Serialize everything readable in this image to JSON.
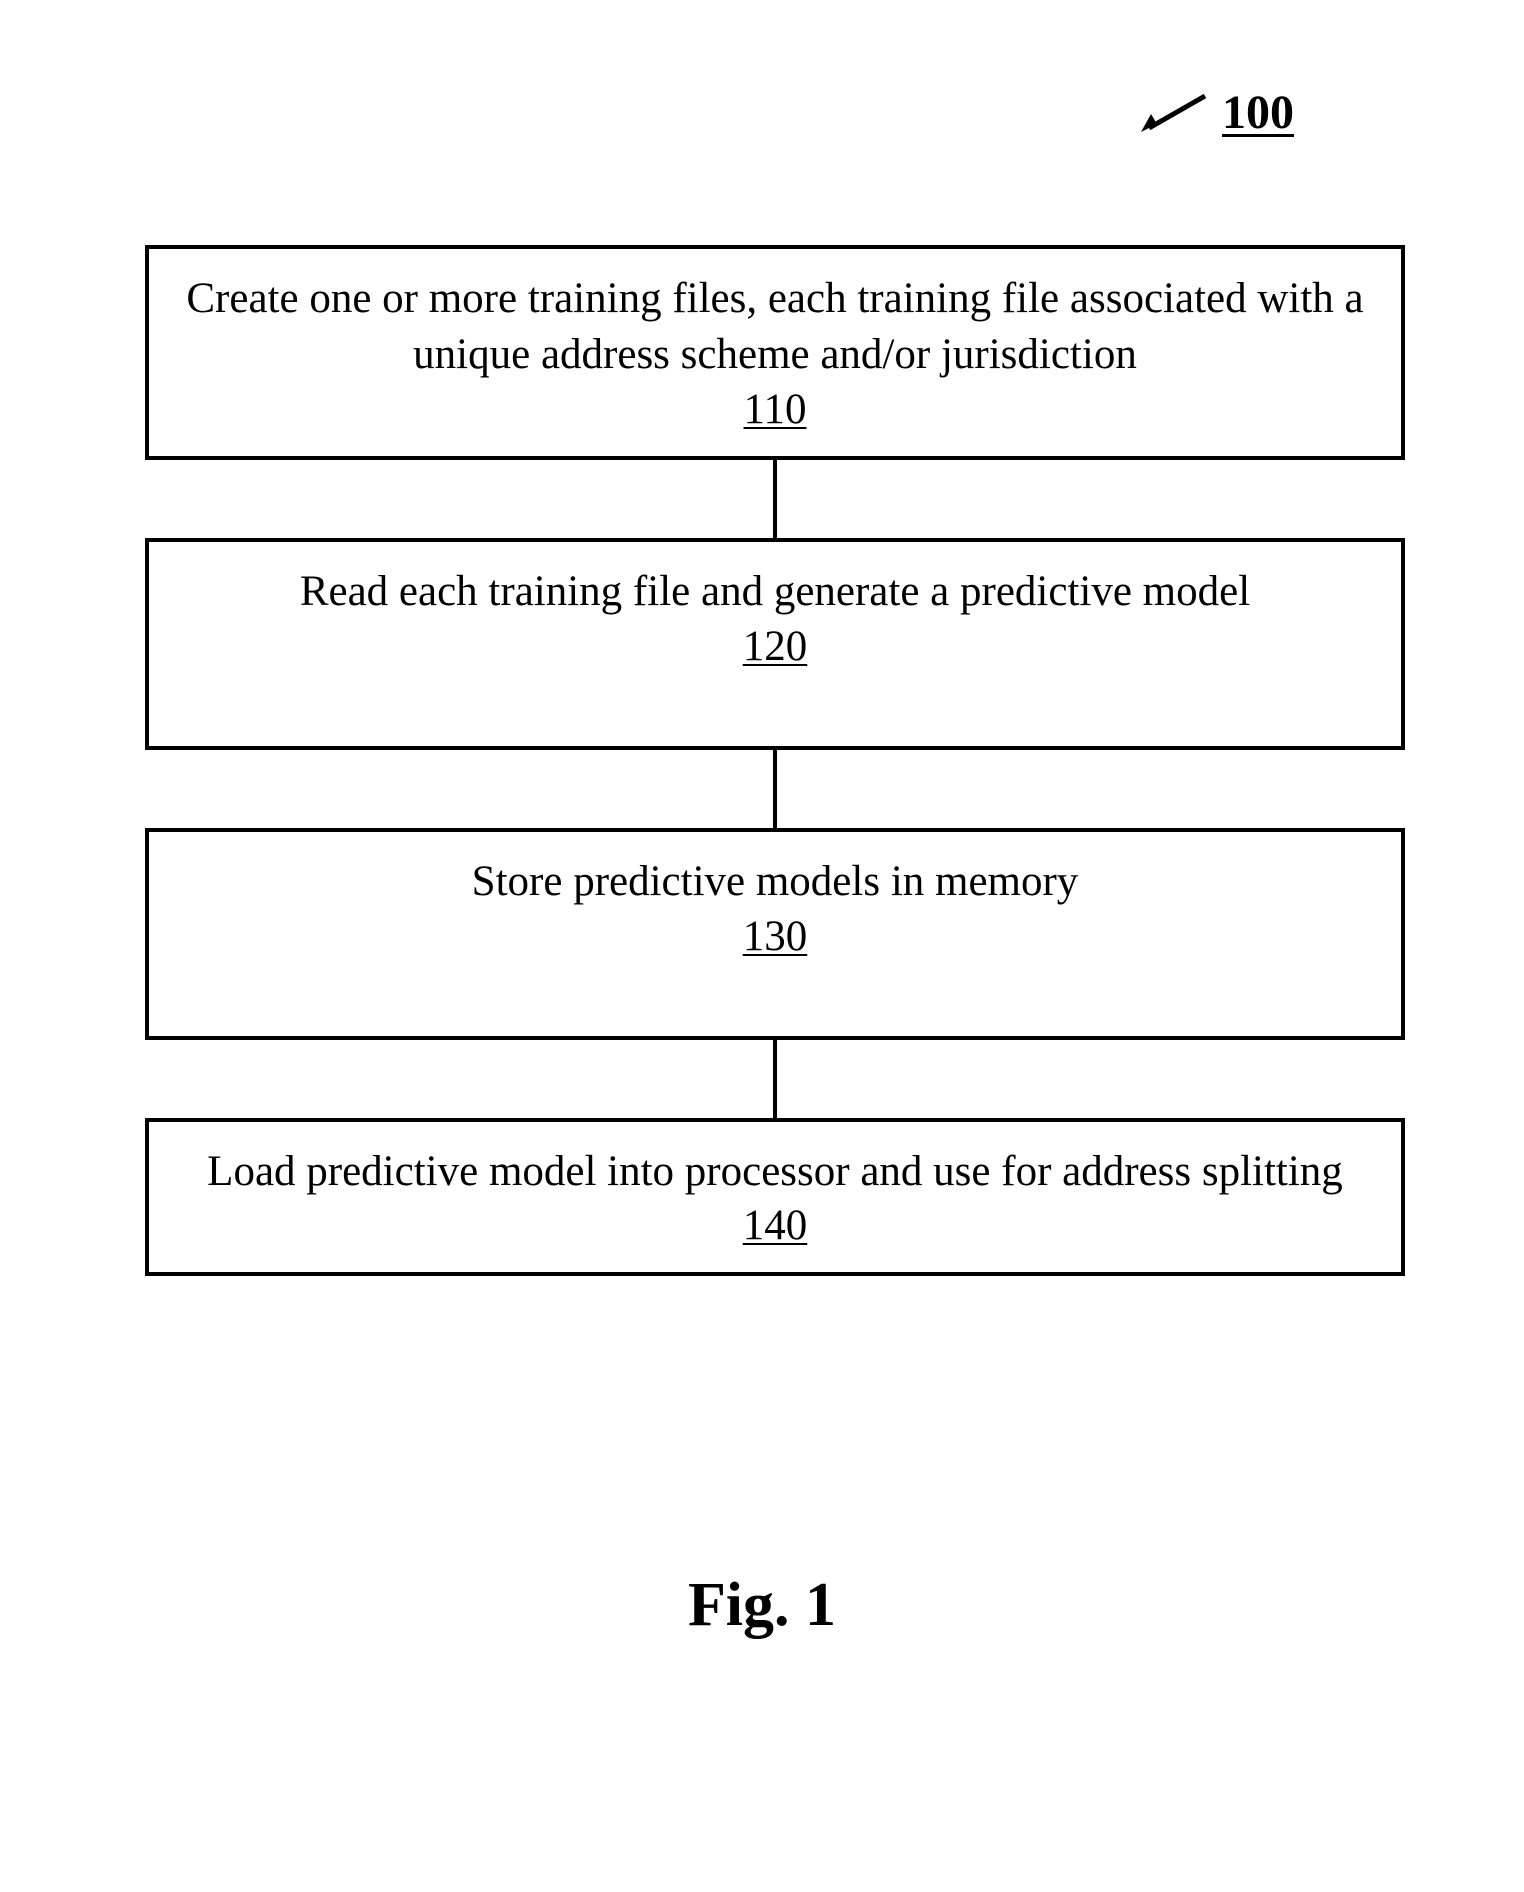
{
  "diagram": {
    "number": "100",
    "figure_label": "Fig. 1",
    "steps": [
      {
        "text": "Create one or more training files, each training file associated with a unique address scheme and/or jurisdiction",
        "number": "110"
      },
      {
        "text": "Read each training file and generate a predictive model",
        "number": "120"
      },
      {
        "text": "Store predictive models in memory",
        "number": "130"
      },
      {
        "text": "Load predictive model into processor and use for address splitting",
        "number": "140"
      }
    ]
  }
}
